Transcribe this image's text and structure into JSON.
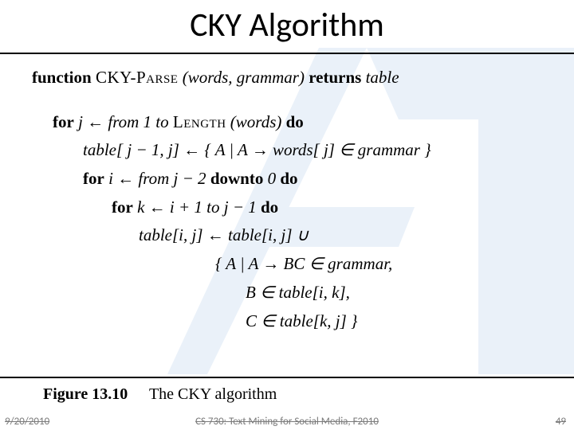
{
  "title": "CKY Algorithm",
  "algo": {
    "fn_kw": "function",
    "fn_name": "CKY-Parse",
    "fn_args": "(words, grammar)",
    "returns_kw": "returns",
    "returns_val": "table",
    "for1_kw": "for",
    "for1_body": " j ← from 1 to ",
    "length_sc": "Length",
    "for1_tail": "(words) ",
    "do_kw": "do",
    "assign1_lhs": "table[ j − 1, j] ← { A | A  →  words[ j]   ∈   grammar  }",
    "for2_kw": "for",
    "for2_body": " i ← from  j − 2 ",
    "downto_kw": "downto",
    "for2_tail": " 0 ",
    "for3_kw": "for",
    "for3_body": " k ← i + 1 to  j − 1 ",
    "assign2": "table[i, j] ← table[i, j]   ∪",
    "setline1": "{ A | A   →   BC   ∈   grammar,",
    "setline2": "  B   ∈   table[i, k],",
    "setline3": "  C   ∈   table[k, j] }"
  },
  "caption": {
    "label": "Figure 13.10",
    "text": "The CKY algorithm"
  },
  "footer": {
    "date": "9/20/2010",
    "course": "CS 730: Text Mining for Social Media, F2010",
    "page": "49"
  }
}
